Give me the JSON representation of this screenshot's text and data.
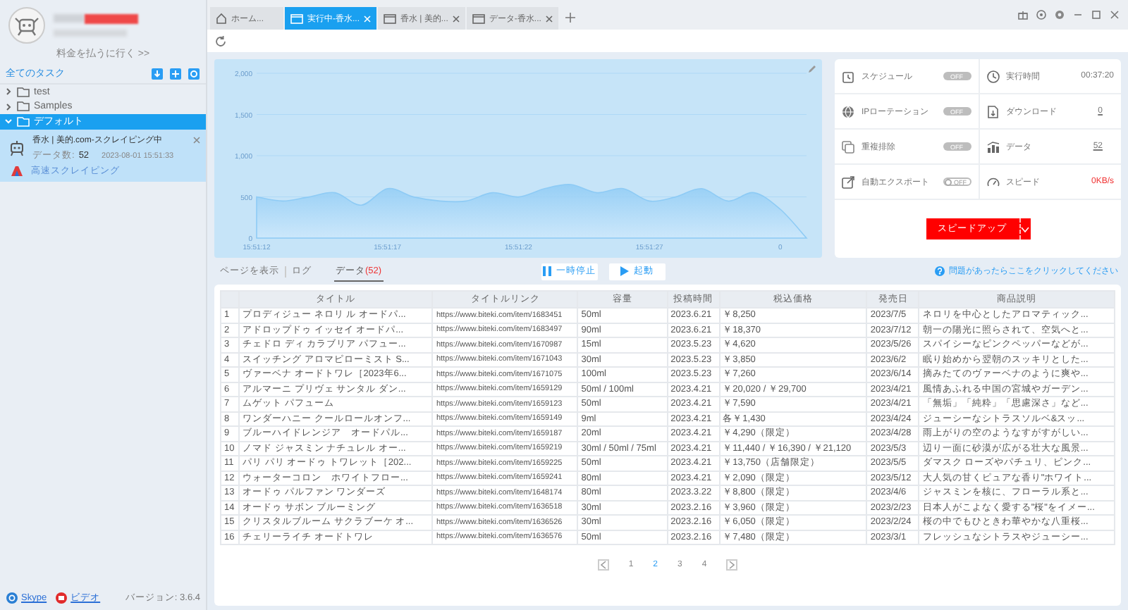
{
  "account": {
    "pay_link": "料金を払うに行く >>"
  },
  "sidebar": {
    "title": "全てのタスク",
    "tree": [
      {
        "label": "test",
        "expanded": false,
        "selected": false
      },
      {
        "label": "Samples",
        "expanded": false,
        "selected": false
      },
      {
        "label": "デフォルト",
        "expanded": true,
        "selected": true,
        "tasks": [
          {
            "name": "香水 | 美的.com-スクレイピング中",
            "count_label": "データ数:",
            "count": "52",
            "time": "2023-08-01 15:51:33",
            "mode": "高速スクレイピング"
          }
        ]
      }
    ],
    "footer": {
      "links": [
        "Skype",
        "ビデオ"
      ],
      "version": "バージョン: 3.6.4"
    }
  },
  "tabs": [
    {
      "label": "ホーム...",
      "kind": "home",
      "selected": false
    },
    {
      "label": "実行中-香水...",
      "kind": "page",
      "selected": true
    },
    {
      "label": "香水 | 美的...",
      "kind": "page",
      "selected": false
    },
    {
      "label": "データ-香水...",
      "kind": "page",
      "selected": false
    }
  ],
  "chart": {
    "chart_data": {
      "type": "area",
      "categories": [
        "15:51:12",
        null,
        null,
        null,
        null,
        "15:51:17",
        null,
        null,
        null,
        null,
        "15:51:22",
        null,
        null,
        null,
        null,
        "15:51:27",
        null,
        null,
        null,
        null,
        "0",
        null
      ],
      "series": [
        {
          "color": "#8ecbf5",
          "values": [
            500,
            450,
            500,
            550,
            400,
            600,
            500,
            450,
            450,
            550,
            500,
            600,
            650,
            550,
            600,
            450,
            500,
            600,
            450,
            550,
            350,
            0
          ]
        }
      ],
      "grid": true,
      "ylim": [
        0,
        2000
      ],
      "yticks": [
        {
          "value": 0,
          "label": "0"
        },
        {
          "value": 500,
          "label": "500"
        },
        {
          "value": 1000,
          "label": "1,000"
        },
        {
          "value": 1500,
          "label": "1,500"
        },
        {
          "value": 2000,
          "label": "2,000"
        }
      ]
    }
  },
  "stats": {
    "toggles": [
      {
        "label": "スケジュール",
        "on": false,
        "disabled": true,
        "state_text": "OFF"
      },
      {
        "label": "IPローテーション",
        "on": false,
        "disabled": true,
        "state_text": "OFF"
      },
      {
        "label": "重複排除",
        "on": false,
        "disabled": true,
        "state_text": "OFF"
      },
      {
        "label": "自動エクスポート",
        "on": false,
        "disabled": false,
        "state_text": "OFF"
      }
    ],
    "metrics": [
      {
        "label": "実行時間",
        "value": "00:37:20",
        "kind": "text"
      },
      {
        "label": "ダウンロード",
        "value": "0",
        "kind": "link"
      },
      {
        "label": "データ",
        "value": "52",
        "kind": "link"
      },
      {
        "label": "スピード",
        "value": "0KB/s",
        "kind": "alert"
      }
    ],
    "speed_up_button": "スピードアップ"
  },
  "view_tabs": [
    {
      "label": "ページを表示",
      "selected": false
    },
    {
      "label": "ログ",
      "selected": false
    },
    {
      "label": "データ",
      "count": "(52)",
      "selected": true
    }
  ],
  "actions": {
    "pause": "一時停止",
    "start": "起動",
    "help": "問題があったらここをクリックしてください"
  },
  "table": {
    "columns": [
      "",
      "タイトル",
      "タイトルリンク",
      "容量",
      "投稿時間",
      "税込価格",
      "発売日",
      "商品説明"
    ],
    "rows": [
      [
        "1",
        "プロディジュー ネロリ ル オードパ...",
        "https://www.biteki.com/item/1683451",
        "50ml",
        "2023.6.21",
        "￥8,250",
        "2023/7/5",
        "ネロリを中心としたアロマティック..."
      ],
      [
        "2",
        "アドロップドゥ イッセイ オードパ...",
        "https://www.biteki.com/item/1683497",
        "90ml",
        "2023.6.21",
        "￥18,370",
        "2023/7/12",
        "朝一の陽光に照らされて、空気へと..."
      ],
      [
        "3",
        "チェドロ ディ カラブリア パフュー...",
        "https://www.biteki.com/item/1670987",
        "15ml",
        "2023.5.23",
        "￥4,620",
        "2023/5/26",
        "スパイシーなピンクペッパーなどが..."
      ],
      [
        "4",
        "スイッチング アロマピローミスト S...",
        "https://www.biteki.com/item/1671043",
        "30ml",
        "2023.5.23",
        "￥3,850",
        "2023/6/2",
        "眠り始めから翌朝のスッキリとした..."
      ],
      [
        "5",
        "ヴァーベナ オードトワレ［2023年6...",
        "https://www.biteki.com/item/1671075",
        "100ml",
        "2023.5.23",
        "￥7,260",
        "2023/6/14",
        "摘みたてのヴァーベナのように爽や..."
      ],
      [
        "6",
        "アルマーニ プリヴェ サンタル ダン...",
        "https://www.biteki.com/item/1659129",
        "50ml / 100ml",
        "2023.4.21",
        "￥20,020 / ￥29,700",
        "2023/4/21",
        "風情あふれる中国の宮城やガーデン..."
      ],
      [
        "7",
        "ムゲット パフューム",
        "https://www.biteki.com/item/1659123",
        "50ml",
        "2023.4.21",
        "￥7,590",
        "2023/4/21",
        "「無垢」「純粋」「思慮深さ」など..."
      ],
      [
        "8",
        "ワンダーハニー クールロールオンフ...",
        "https://www.biteki.com/item/1659149",
        "9ml",
        "2023.4.21",
        "各￥1,430",
        "2023/4/24",
        "ジューシーなシトラスソルベ&スッ..."
      ],
      [
        "9",
        "ブルーハイドレンジア　オードパル...",
        "https://www.biteki.com/item/1659187",
        "20ml",
        "2023.4.21",
        "￥4,290（限定）",
        "2023/4/28",
        "雨上がりの空のようなすがすがしい..."
      ],
      [
        "10",
        "ノマド ジャスミン ナチュレル オー...",
        "https://www.biteki.com/item/1659219",
        "30ml / 50ml / 75ml",
        "2023.4.21",
        "￥11,440 / ￥16,390 / ￥21,120",
        "2023/5/3",
        "辺り一面に砂漠が広がる壮大な風景..."
      ],
      [
        "11",
        "パリ パリ オードゥ トワレット［202...",
        "https://www.biteki.com/item/1659225",
        "50ml",
        "2023.4.21",
        "￥13,750（店舗限定）",
        "2023/5/5",
        "ダマスク ローズやパチュリ、ピンク..."
      ],
      [
        "12",
        "ウォーターコロン　ホワイトフロー...",
        "https://www.biteki.com/item/1659241",
        "80ml",
        "2023.4.21",
        "￥2,090（限定）",
        "2023/5/12",
        "大人気の甘くピュアな香り\"ホワイト..."
      ],
      [
        "13",
        "オードゥ パルファン ワンダーズ",
        "https://www.biteki.com/item/1648174",
        "80ml",
        "2023.3.22",
        "￥8,800（限定）",
        "2023/4/6",
        "ジャスミンを核に、フローラル系と..."
      ],
      [
        "14",
        "オードゥ サボン ブルーミング",
        "https://www.biteki.com/item/1636518",
        "30ml",
        "2023.2.16",
        "￥3,960（限定）",
        "2023/2/23",
        "日本人がこよなく愛する\"桜\"をイメー..."
      ],
      [
        "15",
        "クリスタルブルーム サクラブーケ オ...",
        "https://www.biteki.com/item/1636526",
        "30ml",
        "2023.2.16",
        "￥6,050（限定）",
        "2023/2/24",
        "桜の中でもひときわ華やかな八重桜..."
      ],
      [
        "16",
        "チェリーライチ オードトワレ",
        "https://www.biteki.com/item/1636576",
        "50ml",
        "2023.2.16",
        "￥7,480（限定）",
        "2023/3/1",
        "フレッシュなシトラスやジューシー..."
      ]
    ]
  },
  "pagination": {
    "pages": [
      {
        "label": "1",
        "selected": false
      },
      {
        "label": "2",
        "selected": true
      },
      {
        "label": "3",
        "selected": false
      },
      {
        "label": "4",
        "selected": false
      }
    ]
  }
}
